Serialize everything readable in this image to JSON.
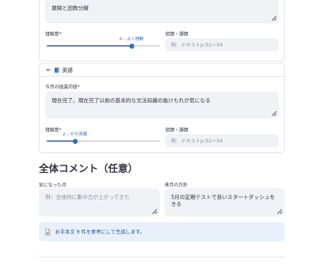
{
  "subject1": {
    "content_value": "展開と因数分解",
    "understanding_label": "理解度",
    "required_mark": "*",
    "slider_value": "4 – よく理解",
    "slider_fraction": 0.75,
    "homework_label": "宿題・課題",
    "homework_placeholder": "例：テキストp.52〜54"
  },
  "subject2": {
    "title": "英語",
    "content_label": "今月の授業内容",
    "required_mark": "*",
    "content_value": "現在完了。現在完了以前の基本的な文法知識の抜けもれが気になる",
    "understanding_label": "理解度",
    "slider_value": "2 – やや苦戦",
    "slider_fraction": 0.25,
    "homework_label": "宿題・課題",
    "homework_placeholder": "例：テキストp.52〜54"
  },
  "overall": {
    "title": "全体コメント（任意）",
    "concerns_label": "気になった点",
    "concerns_placeholder": "例：全体的に集中力が上がってきた",
    "policy_label": "来月の方針",
    "policy_value": "5月の定期テストで良いスタートダッシュをきる"
  },
  "info": {
    "message": "お手本文 9 件を参考にして生成します。"
  },
  "colors": {
    "accent": "#2f6ec1",
    "input_bg": "#f0f2f6",
    "info_bg": "#e8f1fb"
  },
  "icons": {
    "expander": "chevron-down-icon",
    "subject": "blue-book-icon",
    "info": "document-icon"
  }
}
